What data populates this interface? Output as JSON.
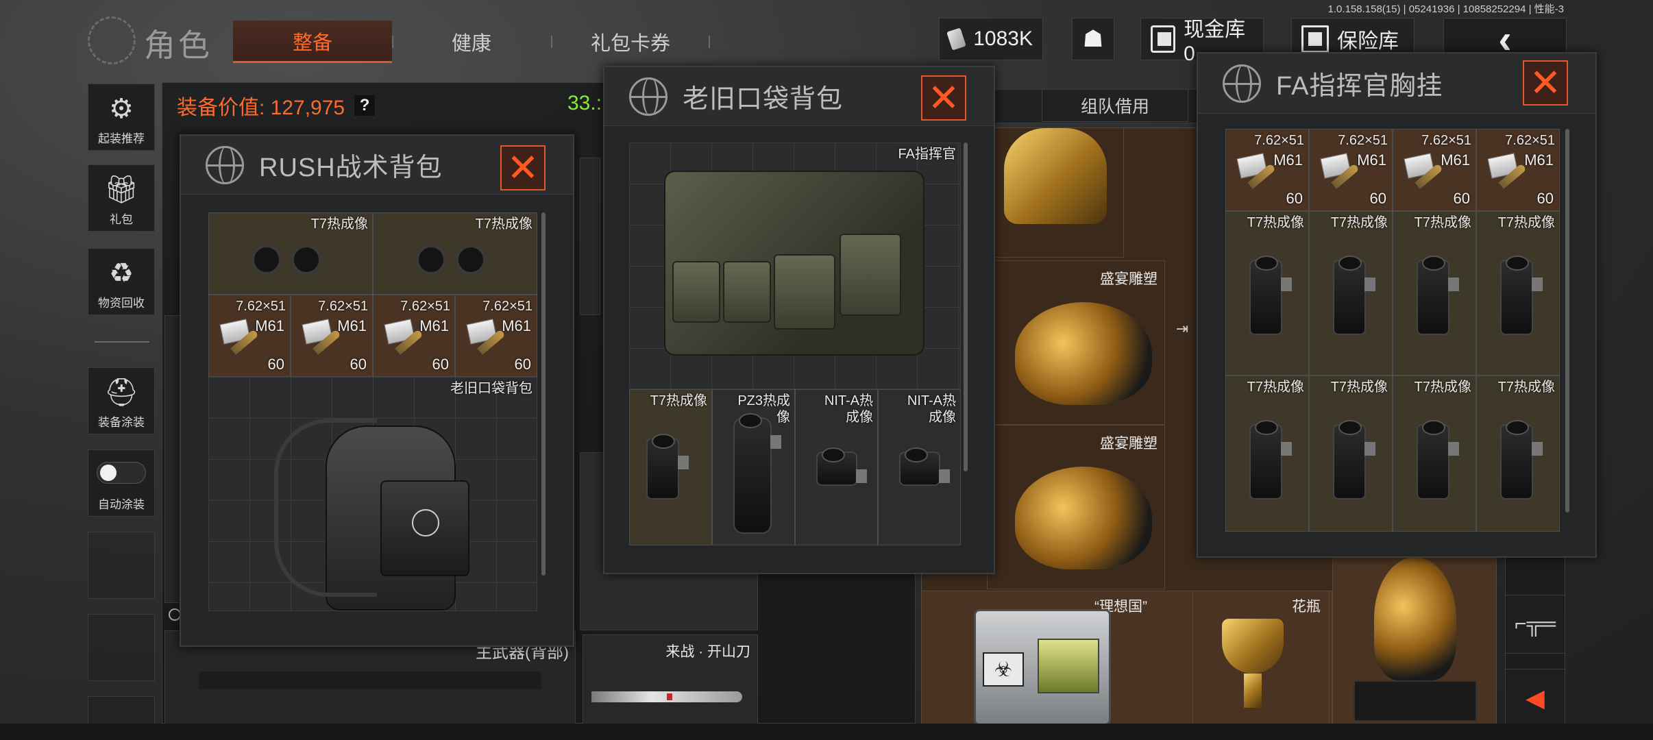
{
  "version_text": "1.0.158.158(15) | 05241936 | 10858252294 | 性能-3",
  "header": {
    "title": "角色",
    "tabs": [
      {
        "label": "整备",
        "active": true
      },
      {
        "label": "健康",
        "active": false
      },
      {
        "label": "礼包卡券",
        "active": false
      }
    ],
    "money": "1083K",
    "cash_vault": "现金库 0",
    "safe": "保险库",
    "back_icon": "chevron-left"
  },
  "sidebar": {
    "items": [
      {
        "label": "起装推荐",
        "icon": "gear-loadout-icon"
      },
      {
        "label": "礼包",
        "icon": "gift-icon"
      },
      {
        "label": "物资回收",
        "icon": "recycle-icon"
      },
      {
        "label": "装备涂装",
        "icon": "helmet-paint-icon"
      },
      {
        "label": "自动涂装",
        "icon": "toggle-icon"
      }
    ]
  },
  "equipment": {
    "value_label": "装备价值: 127,975",
    "help": "?",
    "weight_partial": "33.:"
  },
  "main_labels": {
    "primary_weapon": "主武器(背部)",
    "melee_name": "来战 · 开山刀",
    "team_borrow": "组队借用"
  },
  "colors": {
    "accent": "#ff6a2b",
    "close_border": "#e4572a",
    "value_green": "#8be93a",
    "cell_brown": "#4a3322",
    "window_bg": "#232526"
  },
  "rush_bag": {
    "title": "RUSH战术背包",
    "slots_goggles": [
      {
        "name": "T7热成像"
      },
      {
        "name": "T7热成像"
      }
    ],
    "slots_ammo": [
      {
        "name": "7.62×51",
        "sub": "M61",
        "count": "60"
      },
      {
        "name": "7.62×51",
        "sub": "M61",
        "count": "60"
      },
      {
        "name": "7.62×51",
        "sub": "M61",
        "count": "60"
      },
      {
        "name": "7.62×51",
        "sub": "M61",
        "count": "60"
      }
    ],
    "nested_item": "老旧口袋背包"
  },
  "old_pocket_bag": {
    "title": "老旧口袋背包",
    "vest_name": "FA指挥官",
    "slots": [
      {
        "name": "T7热成像"
      },
      {
        "name": "PZ3热成\n像"
      },
      {
        "name": "NIT-A热\n成像"
      },
      {
        "name": "NIT-A热\n成像"
      }
    ]
  },
  "stash_items": {
    "statue_1": "盛宴雕塑",
    "statue_2": "盛宴雕塑",
    "utopia": "“理想国”",
    "vase": "花瓶"
  },
  "fa_rig": {
    "title": "FA指挥官胸挂",
    "ammo": [
      {
        "name": "7.62×51",
        "sub": "M61",
        "count": "60"
      },
      {
        "name": "7.62×51",
        "sub": "M61",
        "count": "60"
      },
      {
        "name": "7.62×51",
        "sub": "M61",
        "count": "60"
      },
      {
        "name": "7.62×51",
        "sub": "M61",
        "count": "60"
      }
    ],
    "scopes_row1": [
      {
        "name": "T7热成像"
      },
      {
        "name": "T7热成像"
      },
      {
        "name": "T7热成像"
      },
      {
        "name": "T7热成像"
      }
    ],
    "scopes_row2": [
      {
        "name": "T7热成像"
      },
      {
        "name": "T7热成像"
      },
      {
        "name": "T7热成像"
      },
      {
        "name": "T7热成像"
      }
    ]
  }
}
